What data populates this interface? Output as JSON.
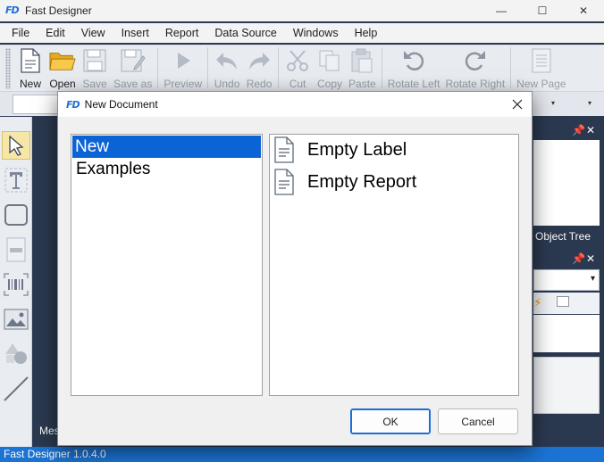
{
  "app": {
    "logo": "FD",
    "title": "Fast Designer"
  },
  "window_controls": {
    "minimize": "—",
    "maximize": "☐",
    "close": "✕"
  },
  "menu": [
    "File",
    "Edit",
    "View",
    "Insert",
    "Report",
    "Data Source",
    "Windows",
    "Help"
  ],
  "toolbar": {
    "new": "New",
    "open": "Open",
    "save": "Save",
    "save_as": "Save as",
    "preview": "Preview",
    "undo": "Undo",
    "redo": "Redo",
    "cut": "Cut",
    "copy": "Copy",
    "paste": "Paste",
    "rotate_left": "Rotate Left",
    "rotate_right": "Rotate Right",
    "new_page": "New Page"
  },
  "panels": {
    "object_tree": "Object Tree",
    "messages_partial": "Mes"
  },
  "status": {
    "version": "Fast Designer 1.0.4.0"
  },
  "dialog": {
    "logo": "FD",
    "title": "New Document",
    "categories": [
      {
        "label": "New",
        "selected": true
      },
      {
        "label": "Examples",
        "selected": false
      }
    ],
    "templates": [
      {
        "label": "Empty Label",
        "icon": "document-icon"
      },
      {
        "label": "Empty Report",
        "icon": "document-icon"
      }
    ],
    "ok_label": "OK",
    "cancel_label": "Cancel"
  },
  "colors": {
    "accent": "#0a64d6",
    "status_bar": "#1b73d3",
    "workspace": "#2b3950"
  }
}
